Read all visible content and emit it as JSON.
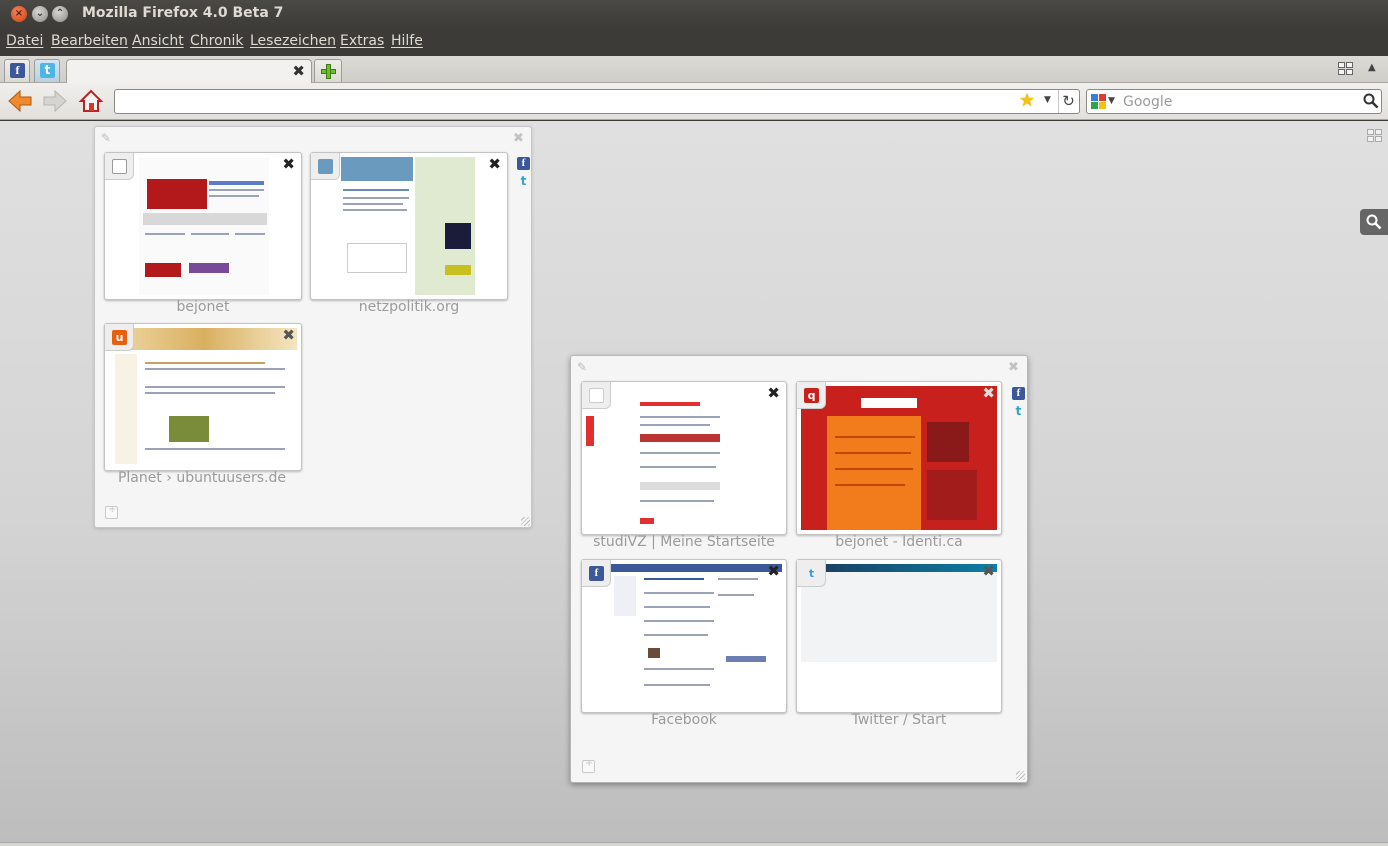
{
  "window": {
    "title": "Mozilla Firefox 4.0 Beta 7",
    "close": "×",
    "minimize": "⌄",
    "maximize": "⌃"
  },
  "menu": [
    "Datei",
    "Bearbeiten",
    "Ansicht",
    "Chronik",
    "Lesezeichen",
    "Extras",
    "Hilfe"
  ],
  "tabs": {
    "app_tabs": [
      {
        "name": "facebook",
        "glyph": "f"
      },
      {
        "name": "twitter",
        "glyph": "t"
      }
    ],
    "active_tab": {
      "label": "",
      "close_glyph": "✖"
    },
    "tab_list_glyph": "▲"
  },
  "navigation": {
    "url_value": "",
    "bookmark_star": "★",
    "dropmarker": "▼",
    "reload": "↻",
    "search_placeholder": "Google",
    "search_dropmarker": "▼"
  },
  "panorama": {
    "group1": {
      "edit_glyph": "✎",
      "close_glyph": "✖",
      "tabs": [
        {
          "title": "bejonet",
          "favicon": "penguin-favicon"
        },
        {
          "title": "netzpolitik.org",
          "favicon": "netzpolitik-favicon"
        },
        {
          "title": "Planet › ubuntuusers.de",
          "favicon": "ubuntuusers-favicon"
        }
      ]
    },
    "group2": {
      "edit_glyph": "✎",
      "close_glyph": "✖",
      "tabs": [
        {
          "title": "studiVZ | Meine Startseite",
          "favicon": "studivz-favicon"
        },
        {
          "title": "bejonet - Identi.ca",
          "favicon": "identica-favicon"
        },
        {
          "title": "Facebook",
          "favicon": "facebook-favicon"
        },
        {
          "title": "Twitter / Start",
          "favicon": "twitter-favicon"
        }
      ]
    },
    "card_close_glyph": "✖",
    "favicon_glyphs": {
      "facebook": "f",
      "identica": "q",
      "twitter": "t",
      "ubuntuusers": "u"
    }
  },
  "colors": {
    "titlebar": "#3c3b37",
    "menu_text": "#dfdbd2",
    "facebook": "#3b5998",
    "twitter": "#2fa2d6",
    "identica_bg": "#c8201c",
    "identica_orange": "#f27b1c",
    "new_tab_green": "#6cbc2e"
  }
}
